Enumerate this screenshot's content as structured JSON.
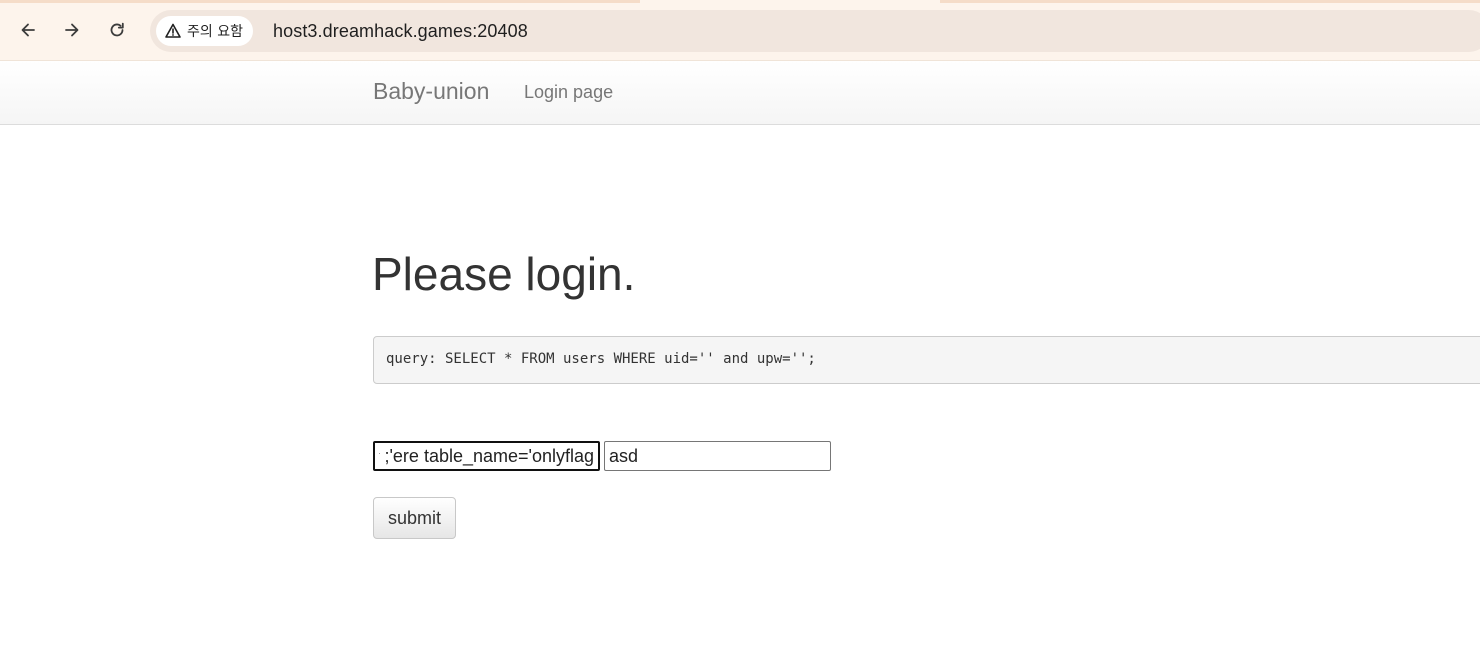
{
  "browser": {
    "security_label": "주의 요함",
    "url": "host3.dreamhack.games:20408",
    "icons": [
      "back-arrow-icon",
      "forward-arrow-icon",
      "reload-icon",
      "warning-triangle-icon"
    ]
  },
  "navbar": {
    "brand": "Baby-union",
    "link_login": "Login page"
  },
  "main": {
    "title": "Please login.",
    "query": "query: SELECT * FROM users WHERE uid='' and upw='';",
    "uid_value": "ere table_name='onlyflag'; #",
    "upw_value": "asd",
    "submit_label": "submit"
  },
  "colors": {
    "chrome_bg": "#fdf4ec",
    "omnibox_bg": "#f1e6de",
    "query_bg": "#f5f5f5",
    "text": "#333333",
    "nav_text": "#777777"
  }
}
